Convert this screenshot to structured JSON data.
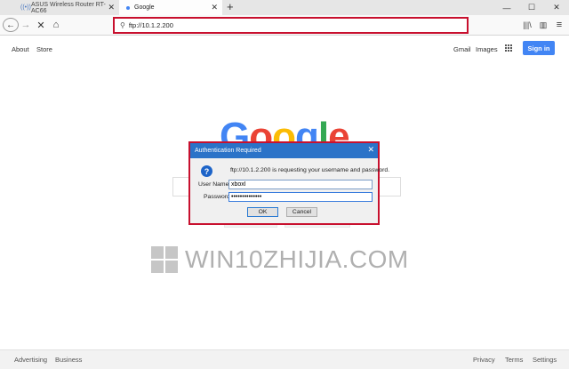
{
  "browser": {
    "tabs": [
      {
        "label": "ASUS Wireless Router RT-AC66"
      },
      {
        "label": "Google"
      }
    ],
    "new_tab_label": "+",
    "window_buttons": {
      "minimize": "—",
      "maximize": "☐",
      "close": "✕"
    },
    "url": "ftp://10.1.2.200"
  },
  "google": {
    "top_left_links": [
      "About",
      "Store"
    ],
    "top_right_links": [
      "Gmail",
      "Images"
    ],
    "signin_label": "Sign in",
    "logo": {
      "letters": [
        "G",
        "o",
        "o",
        "g",
        "l",
        "e"
      ],
      "colors": [
        "#4285f4",
        "#ea4335",
        "#fbbc05",
        "#4285f4",
        "#34a853",
        "#ea4335"
      ]
    },
    "footer_left": [
      "Advertising",
      "Business"
    ],
    "footer_right": [
      "Privacy",
      "Terms",
      "Settings"
    ]
  },
  "watermark": "WIN10ZHIJIA.COM",
  "dialog": {
    "title": "Authentication Required",
    "message": "ftp://10.1.2.200 is requesting your username and password.",
    "username_label": "User Name:",
    "username_value": "xboxl",
    "password_label": "Password:",
    "password_value": "••••••••••••••",
    "ok_label": "OK",
    "cancel_label": "Cancel"
  },
  "colors": {
    "accent_blue": "#4285f4",
    "dialog_title_bar": "#2b73c8",
    "highlight_red": "#c8102e"
  }
}
